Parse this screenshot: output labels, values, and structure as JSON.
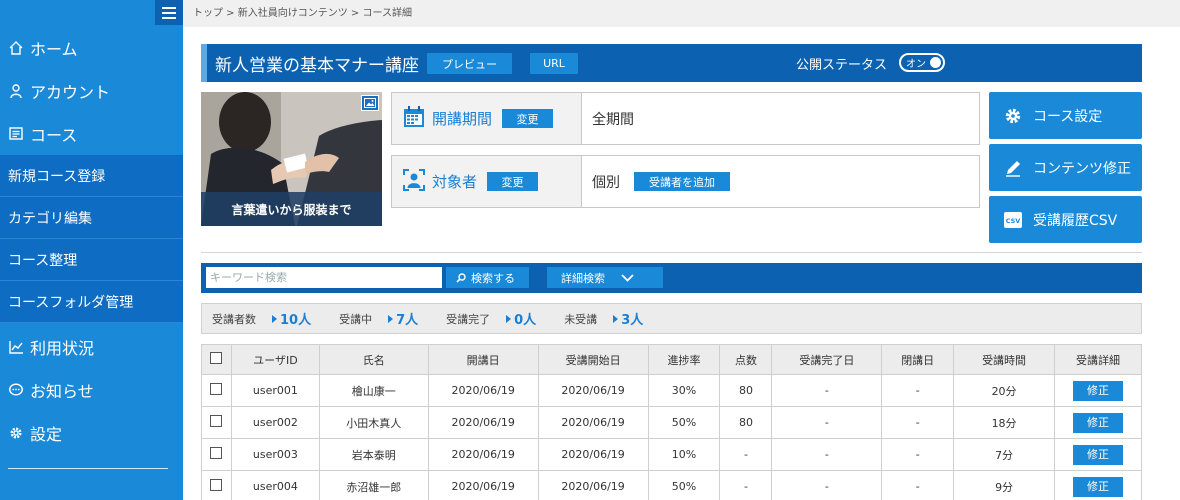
{
  "sidebar": {
    "items": [
      {
        "label": "ホーム",
        "icon": "home-icon"
      },
      {
        "label": "アカウント",
        "icon": "user-icon"
      },
      {
        "label": "コース",
        "icon": "list-icon"
      }
    ],
    "subitems": [
      "新規コース登録",
      "カテゴリ編集",
      "コース整理",
      "コースフォルダ管理"
    ],
    "bottom_items": [
      {
        "label": "利用状況",
        "icon": "chart-icon"
      },
      {
        "label": "お知らせ",
        "icon": "chat-icon"
      },
      {
        "label": "設定",
        "icon": "gear-icon"
      }
    ]
  },
  "breadcrumb": "トップ > 新入社員向けコンテンツ > コース詳細",
  "course": {
    "title": "新人営業の基本マナー講座",
    "preview_label": "プレビュー",
    "url_label": "URL",
    "public_status_label": "公開ステータス",
    "toggle_label": "オン",
    "image_caption": "言葉遣いから服装まで",
    "period_label": "開講期間",
    "period_value": "全期間",
    "target_label": "対象者",
    "target_value": "個別",
    "change_label": "変更",
    "add_learner_label": "受講者を追加"
  },
  "actions": {
    "settings": "コース設定",
    "edit_content": "コンテンツ修正",
    "csv": "受講履歴CSV",
    "csv_badge": "CSV"
  },
  "search": {
    "placeholder": "キーワード検索",
    "search_label": "検索する",
    "advanced_label": "詳細検索"
  },
  "stats": [
    {
      "label": "受講者数",
      "value": "10人"
    },
    {
      "label": "受講中",
      "value": "7人"
    },
    {
      "label": "受講完了",
      "value": "0人"
    },
    {
      "label": "未受講",
      "value": "3人"
    }
  ],
  "table": {
    "headers": [
      "ユーザID",
      "氏名",
      "開講日",
      "受講開始日",
      "進捗率",
      "点数",
      "受講完了日",
      "閉講日",
      "受講時間",
      "受講詳細"
    ],
    "edit_label": "修正",
    "rows": [
      [
        "user001",
        "檜山康一",
        "2020/06/19",
        "2020/06/19",
        "30%",
        "80",
        "-",
        "-",
        "20分"
      ],
      [
        "user002",
        "小田木真人",
        "2020/06/19",
        "2020/06/19",
        "50%",
        "80",
        "-",
        "-",
        "18分"
      ],
      [
        "user003",
        "岩本泰明",
        "2020/06/19",
        "2020/06/19",
        "10%",
        "-",
        "-",
        "-",
        "7分"
      ],
      [
        "user004",
        "赤沼雄一郎",
        "2020/06/19",
        "2020/06/19",
        "50%",
        "-",
        "-",
        "-",
        "9分"
      ]
    ]
  },
  "colors": {
    "primary": "#1a8ad8",
    "dark": "#0c62b0",
    "accent_text": "#1a7fd2"
  }
}
